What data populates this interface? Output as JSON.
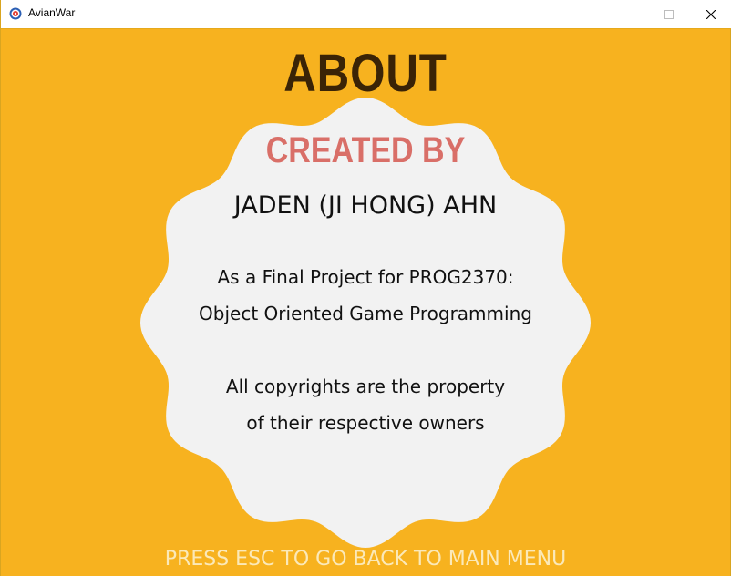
{
  "window": {
    "title": "AvianWar",
    "controls": [
      "minimize",
      "maximize",
      "close"
    ]
  },
  "screen": {
    "heading": "ABOUT",
    "subheading": "CREATED BY",
    "author": "JADEN (JI HONG) AHN",
    "lines": [
      "As a Final Project for PROG2370:",
      "Object Oriented Game Programming",
      "All copyrights are the property",
      "of their respective owners"
    ],
    "footer": "PRESS ESC TO GO BACK TO MAIN MENU"
  },
  "colors": {
    "background": "#f7b21f",
    "badge": "#f2f2f2",
    "heading": "#3a2306",
    "subheading": "#d96f68",
    "footer": "#fbe9b9"
  }
}
